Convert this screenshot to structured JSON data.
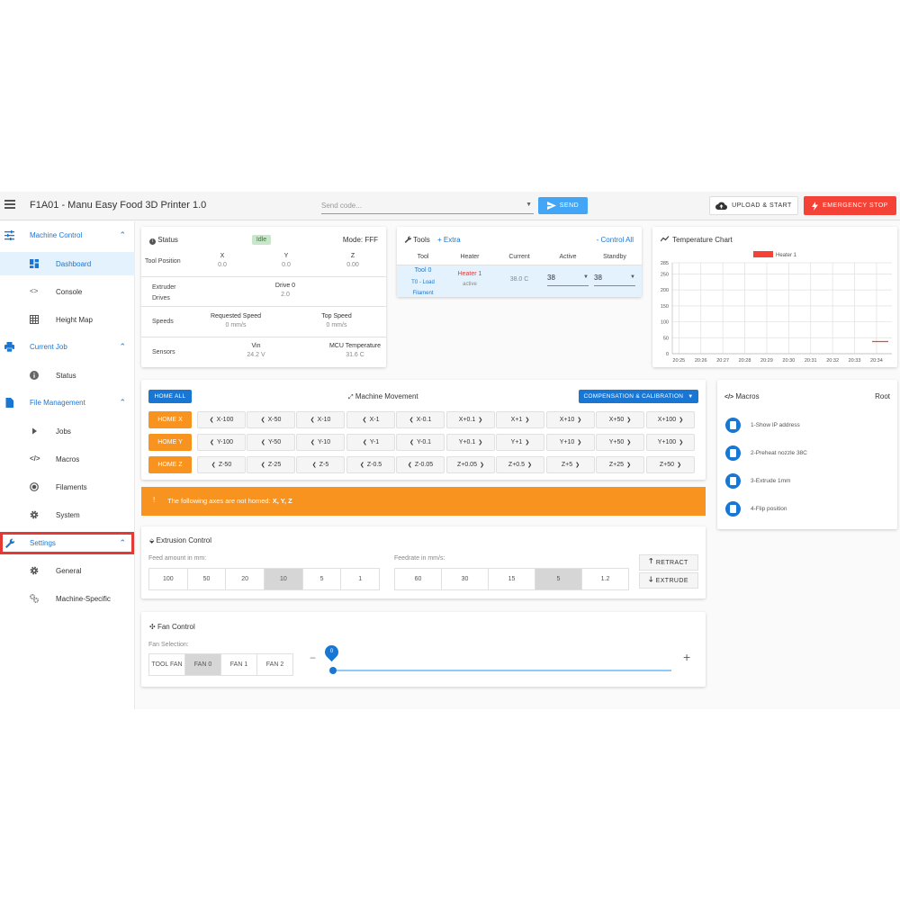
{
  "header": {
    "title": "F1A01 - Manu Easy Food 3D Printer 1.0",
    "send_placeholder": "Send code...",
    "send_label": "SEND",
    "upload_label": "UPLOAD & START",
    "estop_label": "EMERGENCY STOP"
  },
  "sidebar": {
    "groups": [
      {
        "label": "Machine Control",
        "items": [
          {
            "label": "Dashboard"
          },
          {
            "label": "Console"
          },
          {
            "label": "Height Map"
          }
        ]
      },
      {
        "label": "Current Job",
        "items": [
          {
            "label": "Status"
          }
        ]
      },
      {
        "label": "File Management",
        "items": [
          {
            "label": "Jobs"
          },
          {
            "label": "Macros"
          },
          {
            "label": "Filaments"
          },
          {
            "label": "System"
          }
        ]
      },
      {
        "label": "Settings",
        "items": [
          {
            "label": "General"
          },
          {
            "label": "Machine-Specific"
          }
        ]
      }
    ]
  },
  "status": {
    "title": "Status",
    "state": "Idle",
    "mode": "Mode: FFF",
    "tool_position_label": "Tool Position",
    "axes": [
      {
        "name": "X",
        "value": "0.0"
      },
      {
        "name": "Y",
        "value": "0.0"
      },
      {
        "name": "Z",
        "value": "0.00"
      }
    ],
    "extruder_label": "Extruder Drives",
    "extruder_drive": {
      "name": "Drive 0",
      "value": "2.0"
    },
    "speeds_label": "Speeds",
    "requested_speed": {
      "name": "Requested Speed",
      "value": "0 mm/s"
    },
    "top_speed": {
      "name": "Top Speed",
      "value": "0 mm/s"
    },
    "sensors_label": "Sensors",
    "vin": {
      "name": "Vin",
      "value": "24.2 V"
    },
    "mcu": {
      "name": "MCU Temperature",
      "value": "31.6 C"
    }
  },
  "tools": {
    "title": "Tools",
    "extra": "+ Extra",
    "control_all": "- Control All",
    "headers": [
      "Tool",
      "Heater",
      "Current",
      "Active",
      "Standby"
    ],
    "row": {
      "tool": "Tool 0",
      "tool_sub": "T0 - Load Filament",
      "heater": "Heater 1",
      "heater_state": "active",
      "current": "38.0 C",
      "active": "38",
      "standby": "38"
    }
  },
  "temp_chart": {
    "title": "Temperature Chart"
  },
  "chart_data": {
    "type": "line",
    "title": "Temperature Chart",
    "x": [
      "20:25",
      "20:26",
      "20:27",
      "20:28",
      "20:29",
      "20:30",
      "20:31",
      "20:32",
      "20:33",
      "20:34"
    ],
    "y_ticks": [
      0,
      50,
      100,
      150,
      200,
      250,
      285
    ],
    "ylim": [
      0,
      285
    ],
    "grid": true,
    "legend": "top",
    "series": [
      {
        "name": "Heater 1",
        "color": "#f44336",
        "points": [
          {
            "x": "20:33.8",
            "y": 38
          },
          {
            "x": "20:35",
            "y": 38
          }
        ]
      }
    ]
  },
  "movement": {
    "home_all": "HOME ALL",
    "title": "Machine Movement",
    "compensation": "COMPENSATION & CALIBRATION",
    "rows": [
      {
        "home": "HOME X",
        "buttons": [
          "X-100",
          "X-50",
          "X-10",
          "X-1",
          "X-0.1",
          "X+0.1",
          "X+1",
          "X+10",
          "X+50",
          "X+100"
        ]
      },
      {
        "home": "HOME Y",
        "buttons": [
          "Y-100",
          "Y-50",
          "Y-10",
          "Y-1",
          "Y-0.1",
          "Y+0.1",
          "Y+1",
          "Y+10",
          "Y+50",
          "Y+100"
        ]
      },
      {
        "home": "HOME Z",
        "buttons": [
          "Z-50",
          "Z-25",
          "Z-5",
          "Z-0.5",
          "Z-0.05",
          "Z+0.05",
          "Z+0.5",
          "Z+5",
          "Z+25",
          "Z+50"
        ]
      }
    ],
    "alert_text": "The following axes are not homed:",
    "alert_axes": "X, Y, Z"
  },
  "extrusion": {
    "title": "Extrusion Control",
    "feed_label": "Feed amount in mm:",
    "feed_options": [
      "100",
      "50",
      "20",
      "10",
      "5",
      "1"
    ],
    "feed_selected": "10",
    "rate_label": "Feedrate in mm/s:",
    "rate_options": [
      "60",
      "30",
      "15",
      "5",
      "1.2"
    ],
    "rate_selected": "5",
    "retract": "RETRACT",
    "extrude": "EXTRUDE"
  },
  "fan": {
    "title": "Fan Control",
    "selection_label": "Fan Selection:",
    "options": [
      "TOOL FAN",
      "FAN 0",
      "FAN 1",
      "FAN 2"
    ],
    "selected": "FAN 0",
    "value": "0",
    "minus": "−",
    "plus": "+"
  },
  "macros": {
    "title": "Macros",
    "root": "Root",
    "items": [
      "1-Show IP address",
      "2-Preheat nozzle 38C",
      "3-Extrude 1mm",
      "4-Flip position"
    ]
  },
  "colors": {
    "primary": "#1976d2",
    "orange": "#f7931e",
    "danger": "#f44336",
    "send": "#42a5f5"
  }
}
